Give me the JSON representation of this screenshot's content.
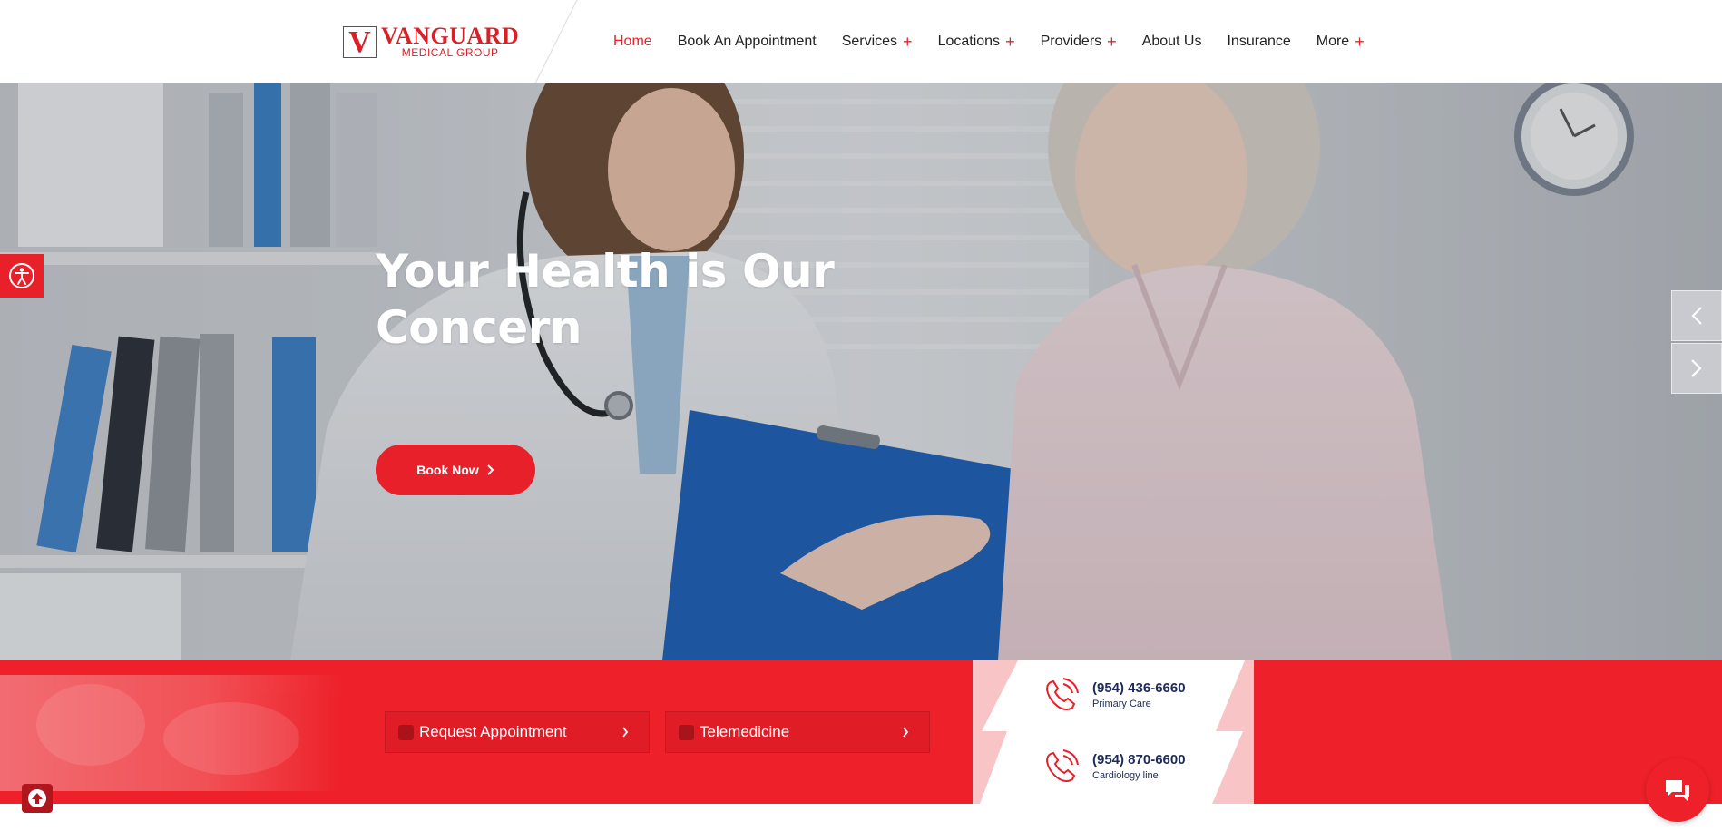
{
  "brand": {
    "logo_mark": "V",
    "name": "VANGUARD",
    "subtitle": "MEDICAL GROUP",
    "accent_color": "#e8202a"
  },
  "nav": {
    "items": [
      {
        "label": "Home",
        "active": true,
        "has_submenu": false
      },
      {
        "label": "Book An Appointment",
        "active": false,
        "has_submenu": false
      },
      {
        "label": "Services",
        "active": false,
        "has_submenu": true
      },
      {
        "label": "Locations",
        "active": false,
        "has_submenu": true
      },
      {
        "label": "Providers",
        "active": false,
        "has_submenu": true
      },
      {
        "label": "About Us",
        "active": false,
        "has_submenu": false
      },
      {
        "label": "Insurance",
        "active": false,
        "has_submenu": false
      },
      {
        "label": "More",
        "active": false,
        "has_submenu": true
      }
    ],
    "submenu_icon": "+"
  },
  "hero": {
    "title_line1": "Your Health is Our",
    "title_line2": "Concern",
    "cta_label": "Book Now",
    "prev_icon": "chevron-left-icon",
    "next_icon": "chevron-right-icon"
  },
  "actions": {
    "request_label": "Request Appointment",
    "telemedicine_label": "Telemedicine"
  },
  "contacts": [
    {
      "number": "(954) 436-6660",
      "label": "Primary Care",
      "icon": "phone-icon"
    },
    {
      "number": "(954) 870-6600",
      "label": "Cardiology line",
      "icon": "phone-icon"
    }
  ],
  "widgets": {
    "accessibility_icon": "accessibility-icon",
    "scroll_top_icon": "arrow-up-icon",
    "chat_icon": "chat-icon"
  }
}
